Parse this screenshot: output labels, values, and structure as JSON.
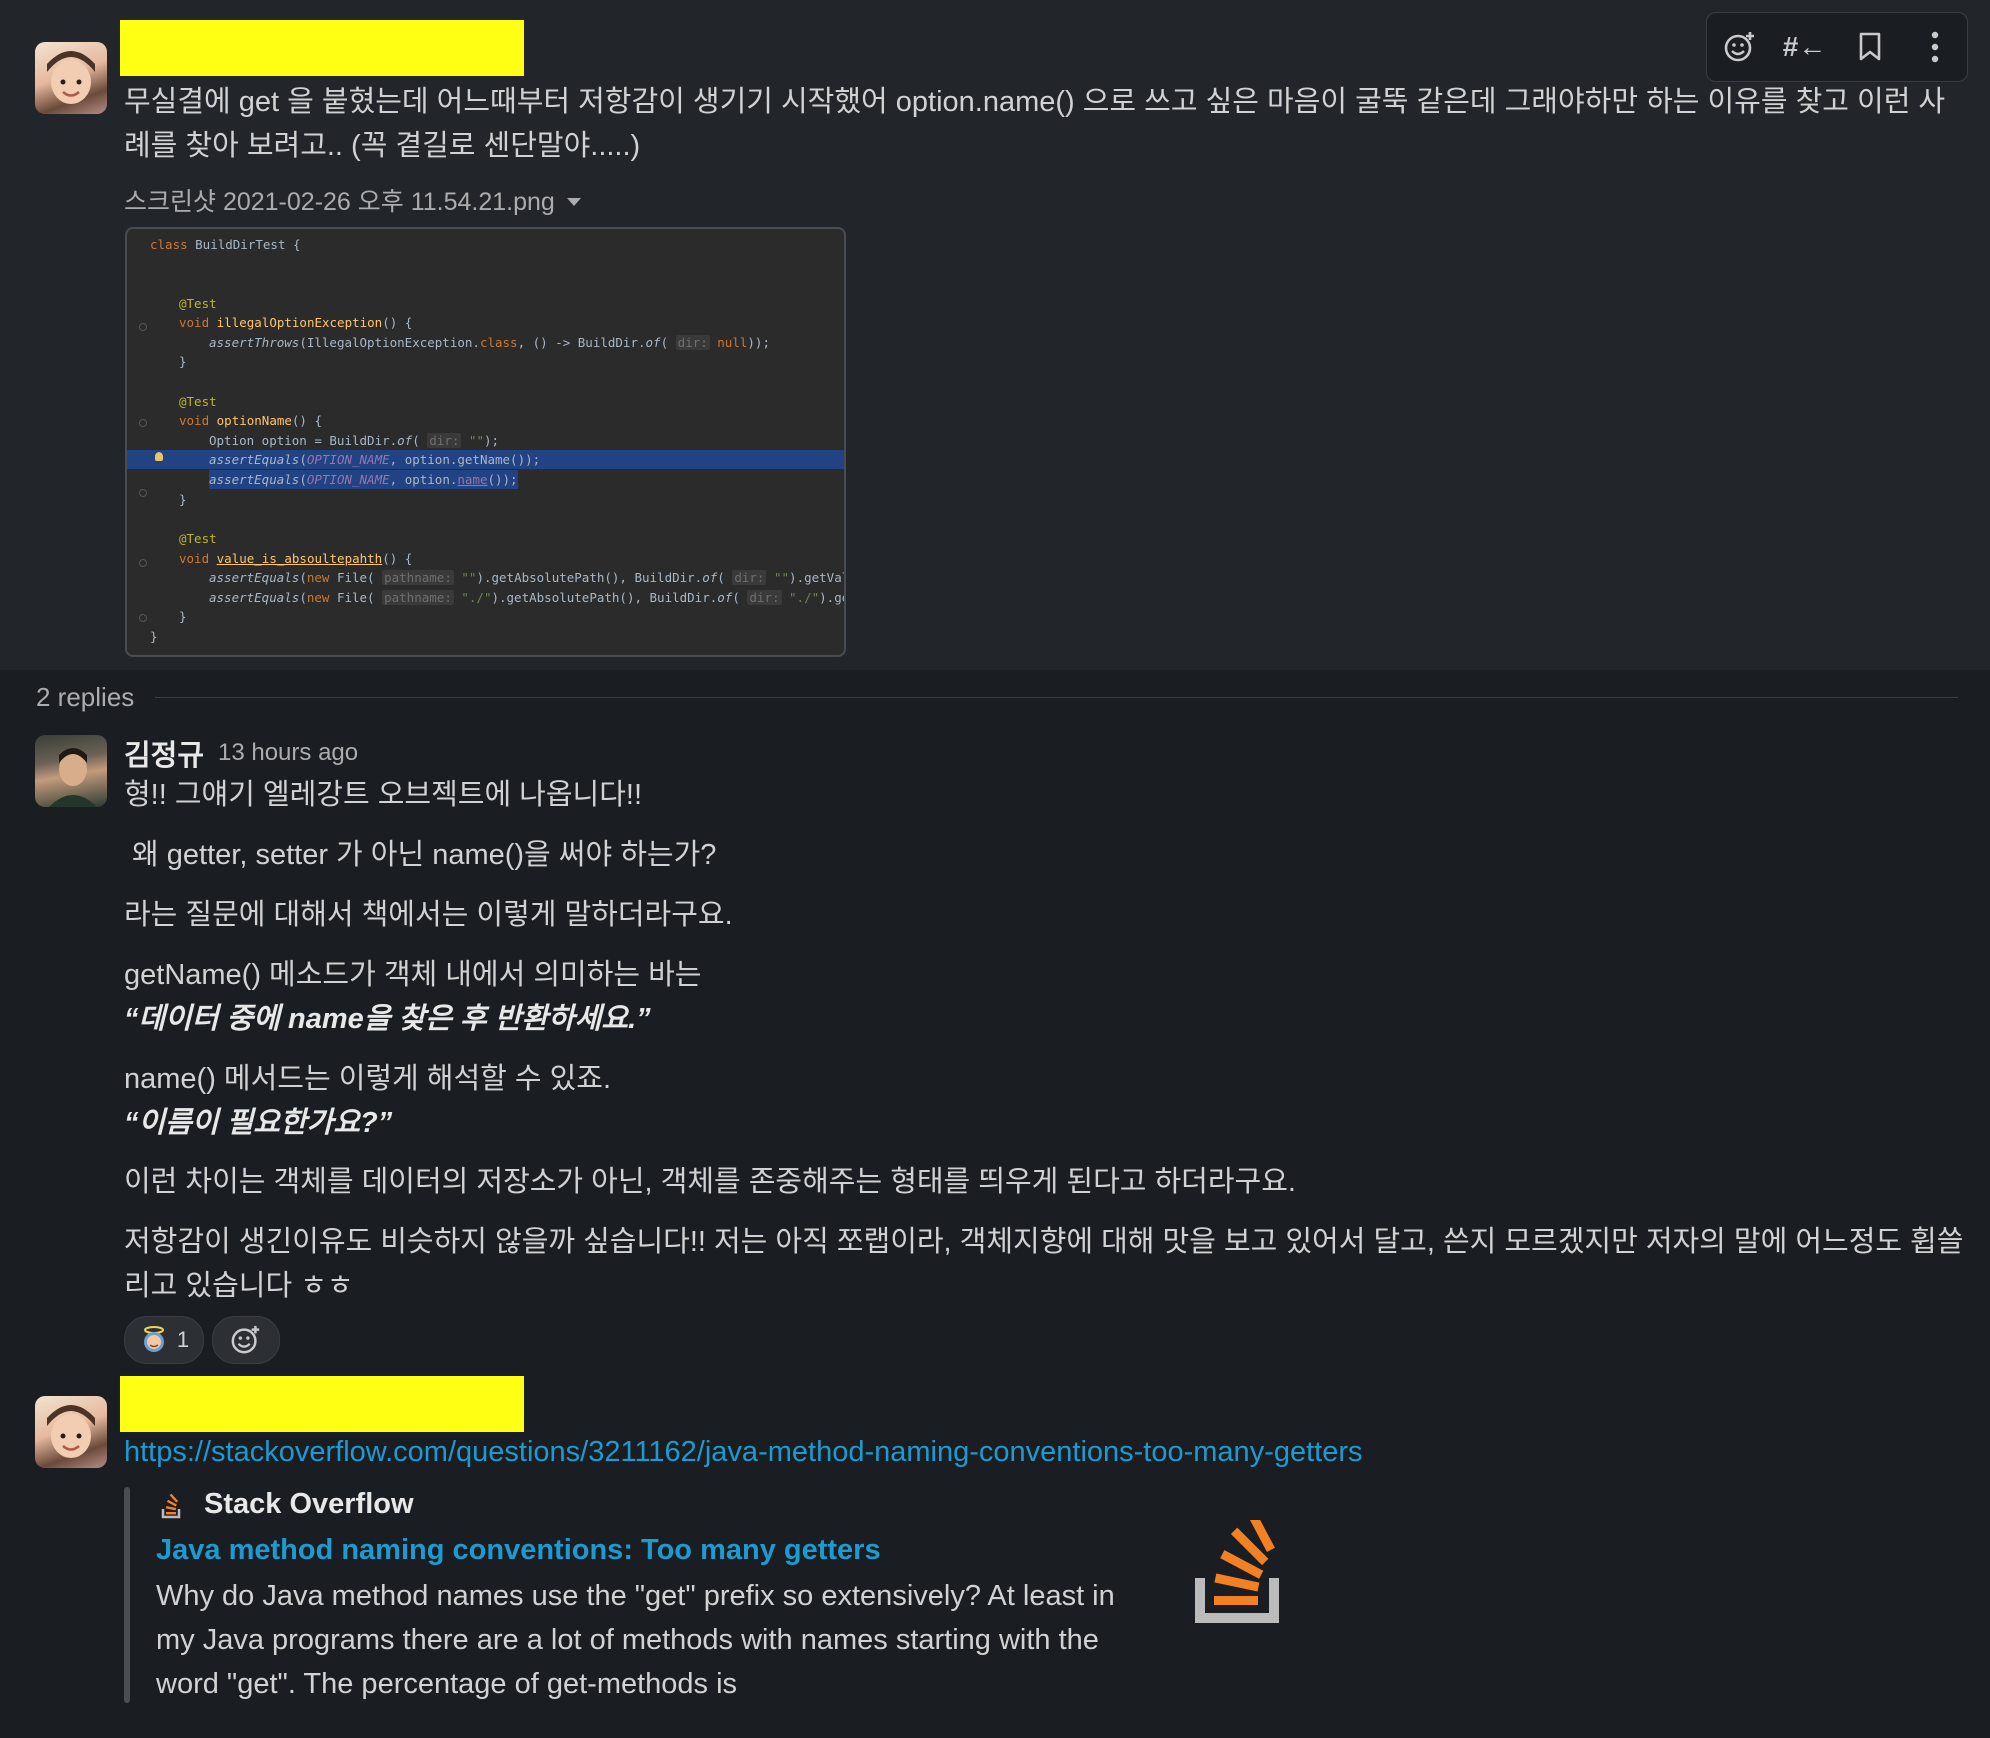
{
  "message1": {
    "text": "무실결에 get 을 붙혔는데 어느때부터 저항감이 생기기 시작했어 option.name() 으로 쓰고 싶은 마음이 굴뚝 같은데 그래야하만 하는 이유를 찾고 이런 사례를 찾아 보려고.. (꼭 곁길로 센단말야.....)",
    "file_name": "스크린샷 2021-02-26 오후 11.54.21.png"
  },
  "toolbar": {
    "icons": [
      "add-reaction-icon",
      "reply-in-thread-icon",
      "bookmark-icon",
      "more-actions-icon"
    ],
    "reply_label": "#←"
  },
  "code": {
    "lines": [
      "class BuildDirTest {",
      "@Test",
      "void illegalOptionException() {",
      "assertThrows(IllegalOptionException.class, () -> BuildDir.of( dir: null));",
      "}",
      "@Test",
      "void optionName() {",
      "Option option = BuildDir.of( dir: \"\");",
      "assertEquals(OPTION_NAME, option.getName());",
      "assertEquals(OPTION_NAME, option.name());",
      "}",
      "@Test",
      "void value_is_absoultepahth() {",
      "assertEquals(new File( pathname: \"\").getAbsolutePath(), BuildDir.of( dir: \"\").getValue());",
      "assertEquals(new File( pathname: \"./\").getAbsolutePath(), BuildDir.of( dir: \"./\").getValue",
      "}",
      "}"
    ]
  },
  "thread": {
    "replies_label": "2 replies"
  },
  "reply1": {
    "author": "김정규",
    "time": "13 hours ago",
    "p1": "형!! 그얘기 엘레강트 오브젝트에 나옵니다!!",
    "p2": " 왜 getter, setter 가 아닌 name()을 써야 하는가?",
    "p3": "라는 질문에 대해서 책에서는 이렇게 말하더라구요.",
    "p4a": "getName() 메소드가 객체 내에서 의미하는 바는",
    "p4b": "“데이터 중에 name을 찾은 후 반환하세요.”",
    "p5a": "name() 메서드는 이렇게 해석할 수 있죠.",
    "p5b": "“이름이 필요한가요?”",
    "p6": "이런 차이는 객체를 데이터의 저장소가 아닌, 객체를 존중해주는 형태를 띄우게 된다고 하더라구요.",
    "p7": "저항감이 생긴이유도 비슷하지 않을까 싶습니다!! 저는 아직 쪼랩이라, 객체지향에 대해 맛을 보고 있어서 달고, 쓴지 모르겠지만 저자의 말에 어느정도 휩쓸리고 있습니다 ㅎㅎ",
    "reaction_count": "1"
  },
  "reply2": {
    "link": "https://stackoverflow.com/questions/3211162/java-method-naming-conventions-too-many-getters",
    "unfurl": {
      "site": "Stack Overflow",
      "title": "Java method naming conventions: Too many getters",
      "description": "Why do Java method names use the \"get\" prefix so extensively? At least in my Java programs there are a lot of methods with names starting with the word \"get\". The percentage of get-methods is"
    }
  },
  "colors": {
    "background": "#1a1d21",
    "hover_background": "#222529",
    "link": "#1d9bd1",
    "redaction": "#ffff14",
    "stackoverflow_orange": "#f48024"
  }
}
